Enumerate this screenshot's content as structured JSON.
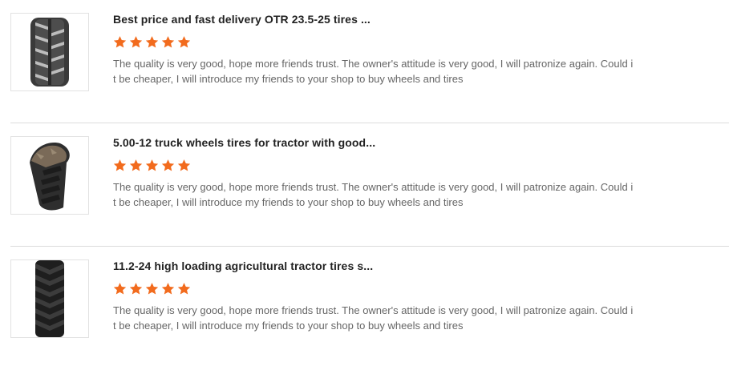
{
  "reviews": [
    {
      "product_icon": "otr-loader-tire-image",
      "title": "Best price and fast delivery OTR 23.5-25 tires ...",
      "rating": 5,
      "rating_max": 5,
      "comment": "The quality is very good, hope more friends trust. The owner's attitude is very good, I will patronize again. Could it be cheaper, I will introduce my friends to your shop to buy wheels and tires"
    },
    {
      "product_icon": "tractor-tire-image",
      "title": "5.00-12 truck wheels tires for tractor with good...",
      "rating": 5,
      "rating_max": 5,
      "comment": "The quality is very good, hope more friends trust. The owner's attitude is very good, I will patronize again. Could it be cheaper, I will introduce my friends to your shop to buy wheels and tires"
    },
    {
      "product_icon": "agricultural-tire-image",
      "title": "11.2-24 high loading agricultural tractor tires s...",
      "rating": 5,
      "rating_max": 5,
      "comment": "The quality is very good, hope more friends trust. The owner's attitude is very good, I will patronize again. Could it be cheaper, I will introduce my friends to your shop to buy wheels and tires"
    }
  ],
  "colors": {
    "star": "#f26b1d",
    "title": "#222222",
    "comment": "#666666",
    "divider": "#dcdcdc"
  }
}
